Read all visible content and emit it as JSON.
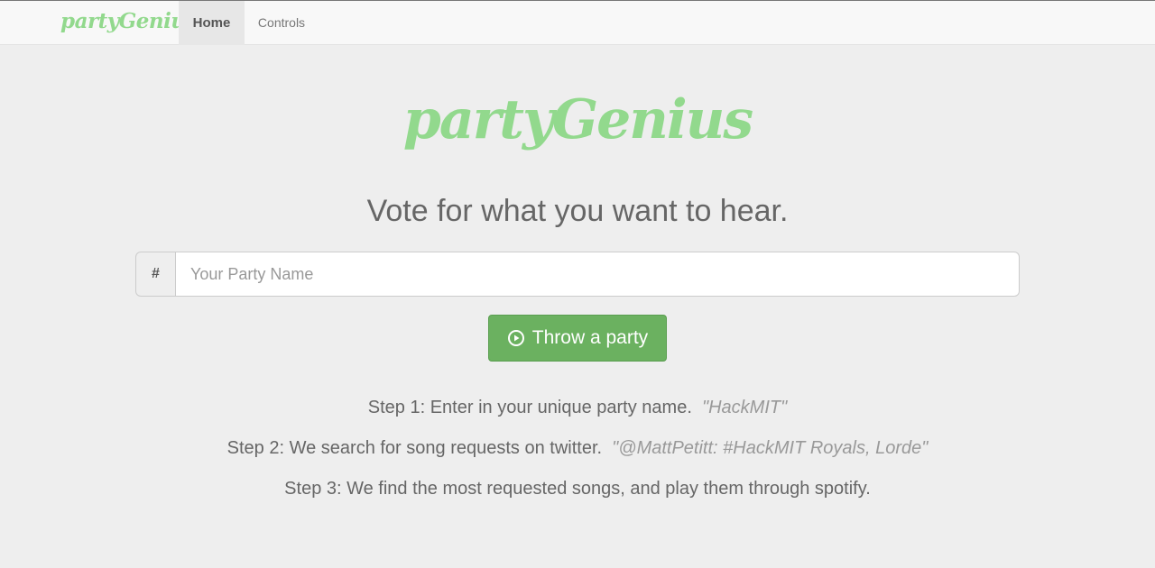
{
  "navbar": {
    "brand": "partyGenius",
    "links": [
      {
        "label": "Home",
        "active": true
      },
      {
        "label": "Controls",
        "active": false
      }
    ]
  },
  "hero": {
    "logo": "partyGenius",
    "tagline": "Vote for what you want to hear."
  },
  "party_form": {
    "addon": "#",
    "value": "",
    "placeholder": "Your Party Name",
    "button_label": "Throw a party",
    "button_icon": "play-circle-icon"
  },
  "steps": [
    {
      "text": "Step 1: Enter in your unique party name.  ",
      "example": "\"HackMIT\""
    },
    {
      "text": "Step 2: We search for song requests on twitter.  ",
      "example": "\"@MattPetitt: #HackMIT Royals, Lorde\""
    },
    {
      "text": "Step 3: We find the most requested songs, and play them through spotify.",
      "example": ""
    }
  ],
  "colors": {
    "brand_green": "#92d98d",
    "button_green": "#6bb160",
    "background": "#eeeeee"
  }
}
